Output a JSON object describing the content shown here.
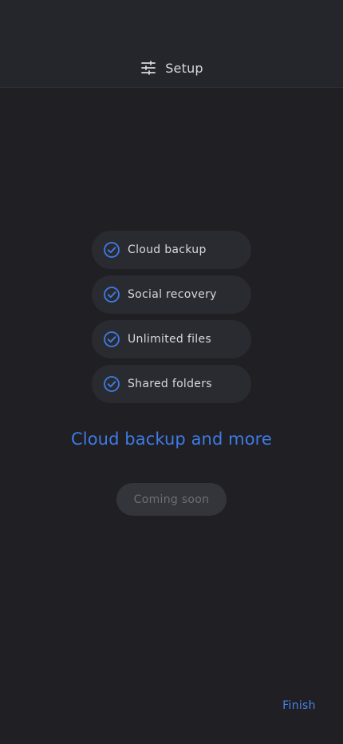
{
  "header": {
    "title": "Setup",
    "icon": "sliders-icon"
  },
  "features": {
    "items": [
      {
        "label": "Cloud backup",
        "icon": "check-circle-icon"
      },
      {
        "label": "Social recovery",
        "icon": "check-circle-icon"
      },
      {
        "label": "Unlimited files",
        "icon": "check-circle-icon"
      },
      {
        "label": "Shared folders",
        "icon": "check-circle-icon"
      }
    ]
  },
  "main": {
    "headline": "Cloud backup and more",
    "coming_soon_label": "Coming soon"
  },
  "footer": {
    "finish_label": "Finish"
  },
  "colors": {
    "background": "#1f1f24",
    "header_background": "#25262b",
    "accent": "#3f7be6",
    "pill_background": "#2a2b31",
    "disabled_button": "#34353b"
  }
}
